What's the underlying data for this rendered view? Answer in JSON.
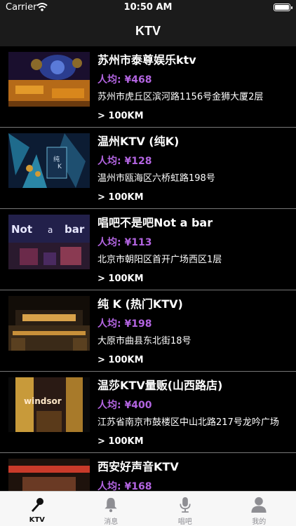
{
  "status": {
    "carrier": "Carrier",
    "time": "10:50 AM"
  },
  "nav": {
    "title": "KTV"
  },
  "items": [
    {
      "name": "苏州市泰尊娱乐ktv",
      "price": "人均: ¥468",
      "address": "苏州市虎丘区滨河路1156号金狮大厦2层",
      "distance": "> 100KM"
    },
    {
      "name": "温州KTV (纯K)",
      "price": "人均: ¥128",
      "address": "温州市瓯海区六桥虹路198号",
      "distance": "> 100KM"
    },
    {
      "name": "唱吧不是吧Not a bar",
      "price": "人均: ¥113",
      "address": "北京市朝阳区首开广场西区1层",
      "distance": "> 100KM"
    },
    {
      "name": "纯 K (热门KTV)",
      "price": "人均: ¥198",
      "address": "大原市曲县东北街18号",
      "distance": "> 100KM"
    },
    {
      "name": "温莎KTV量贩(山西路店)",
      "price": "人均: ¥400",
      "address": "江苏省南京市鼓楼区中山北路217号龙吟广场",
      "distance": "> 100KM"
    },
    {
      "name": "西安好声音KTV",
      "price": "人均: ¥168",
      "address": "",
      "distance": ""
    }
  ],
  "thumb_text": {
    "item3_left": "Not",
    "item3_mid": "a",
    "item3_right": "bar",
    "item5_sign": "windsor"
  },
  "tabs": [
    {
      "label": "KTV",
      "icon": "microphone-icon",
      "active": true
    },
    {
      "label": "消息",
      "icon": "bell-icon",
      "active": false
    },
    {
      "label": "唱吧",
      "icon": "mic-icon",
      "active": false
    },
    {
      "label": "我的",
      "icon": "person-icon",
      "active": false
    }
  ],
  "colors": {
    "accent": "#b264e0",
    "bar": "#1b1b1b",
    "background": "#000000",
    "tabbar": "#f7f7f7"
  }
}
